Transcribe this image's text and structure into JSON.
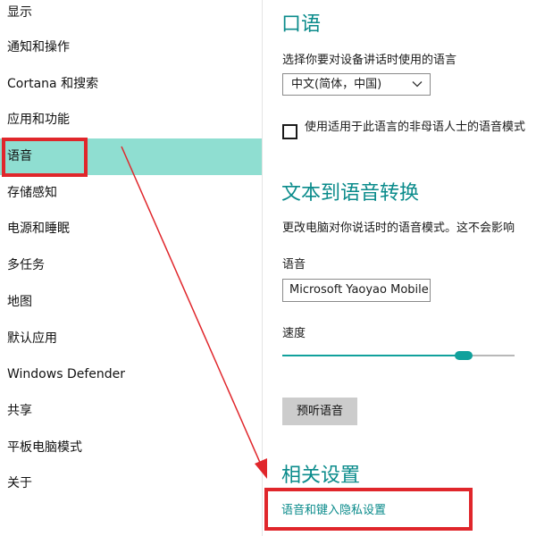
{
  "sidebar": {
    "items": [
      {
        "label": "显示"
      },
      {
        "label": "通知和操作"
      },
      {
        "label": "Cortana 和搜索"
      },
      {
        "label": "应用和功能"
      },
      {
        "label": "语音",
        "selected": true
      },
      {
        "label": "存储感知"
      },
      {
        "label": "电源和睡眠"
      },
      {
        "label": "多任务"
      },
      {
        "label": "地图"
      },
      {
        "label": "默认应用"
      },
      {
        "label": "Windows Defender"
      },
      {
        "label": "共享"
      },
      {
        "label": "平板电脑模式"
      },
      {
        "label": "关于"
      }
    ]
  },
  "speech": {
    "heading": "口语",
    "language_prompt": "选择你要对设备讲话时使用的语言",
    "language_select": {
      "value": "中文(简体，中国)"
    },
    "non_native_checkbox": {
      "checked": false,
      "label": "使用适用于此语言的非母语人士的语音模式"
    }
  },
  "tts": {
    "heading": "文本到语音转换",
    "description": "更改电脑对你说话时的语音模式。这不会影响",
    "voice_label": "语音",
    "voice_value": "Microsoft Yaoyao Mobile",
    "speed_label": "速度",
    "speed_fraction": 0.78,
    "preview_button": "预听语音"
  },
  "related": {
    "heading": "相关设置",
    "privacy_link": "语音和键入隐私设置"
  },
  "icons": {
    "dropdown": "chevron-down-icon"
  },
  "colors": {
    "accent": "#0a8b8b",
    "selection": "#8fded1",
    "annotation": "#e0262b"
  }
}
